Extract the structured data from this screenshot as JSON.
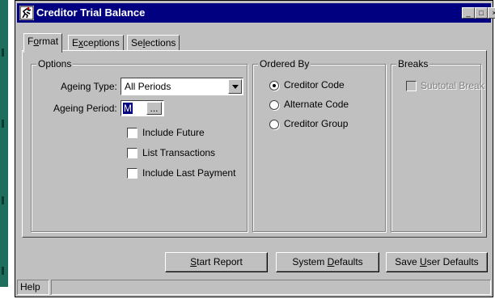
{
  "window": {
    "title": "Creditor Trial Balance",
    "title_bar_color": "#000080",
    "controls": {
      "minimize": "_",
      "maximize": "□",
      "close": "×"
    }
  },
  "tabs": [
    {
      "label_pre": "F",
      "label_u": "o",
      "label_post": "rmat",
      "active": true
    },
    {
      "label_pre": "E",
      "label_u": "x",
      "label_post": "ceptions",
      "active": false
    },
    {
      "label_pre": "Se",
      "label_u": "l",
      "label_post": "ections",
      "active": false
    }
  ],
  "options": {
    "title": "Options",
    "ageing_type_label": "Ageing Type:",
    "ageing_type_value": "All Periods",
    "ageing_period_label": "Ageing Period:",
    "ageing_period_value": "M",
    "ellipsis": "...",
    "checkboxes": [
      {
        "label": "Include Future",
        "checked": false
      },
      {
        "label": "List Transactions",
        "checked": false
      },
      {
        "label": "Include Last Payment",
        "checked": false
      }
    ]
  },
  "ordered_by": {
    "title": "Ordered By",
    "radios": [
      {
        "label": "Creditor Code",
        "checked": true
      },
      {
        "label": "Alternate Code",
        "checked": false
      },
      {
        "label": "Creditor Group",
        "checked": false
      }
    ]
  },
  "breaks": {
    "title": "Breaks",
    "subtotal_label": "Subtotal Break",
    "subtotal_checked": false,
    "subtotal_enabled": false
  },
  "buttons": {
    "start_report": {
      "pre": "",
      "u": "S",
      "post": "tart Report"
    },
    "system_defaults": {
      "pre": "System ",
      "u": "D",
      "post": "efaults"
    },
    "save_user_defaults": {
      "pre": "Save ",
      "u": "U",
      "post": "ser Defaults"
    }
  },
  "status_bar": {
    "text": "Help"
  }
}
